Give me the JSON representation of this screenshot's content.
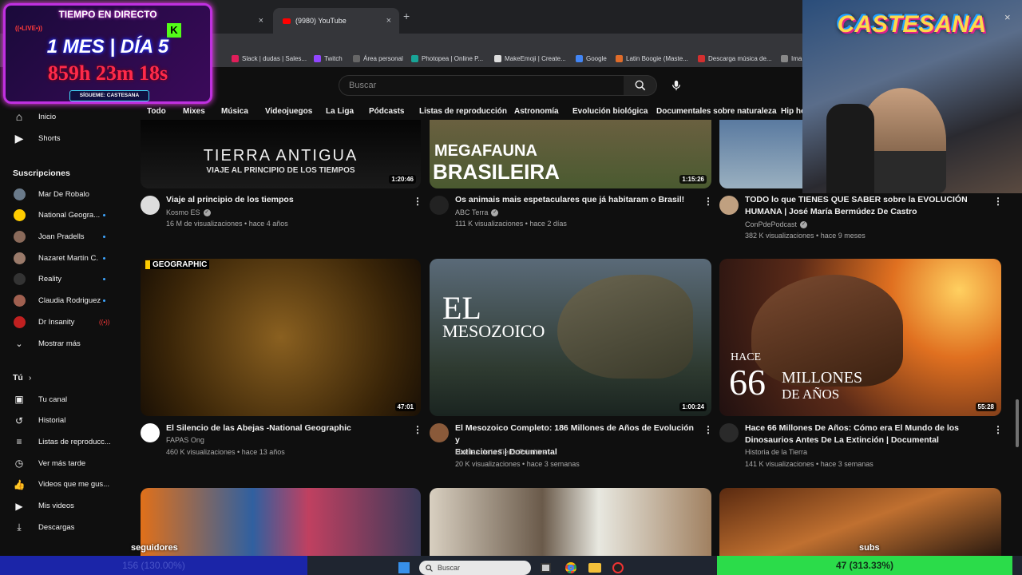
{
  "browser": {
    "active_tab_title": "(9980) YouTube",
    "new_tab_symbol": "+",
    "close_symbol": "×",
    "bookmarks": [
      {
        "label": "Slack | dudas | Sales...",
        "color": "#e01e5a"
      },
      {
        "label": "Twitch",
        "color": "#9146ff"
      },
      {
        "label": "Área personal",
        "color": "#666666"
      },
      {
        "label": "Photopea | Online P...",
        "color": "#18a497"
      },
      {
        "label": "MakeEmoji | Create...",
        "color": "#dddddd"
      },
      {
        "label": "Google",
        "color": "#4285f4"
      },
      {
        "label": "Latin Boogie (Maste...",
        "color": "#e06c2a"
      },
      {
        "label": "Descarga música de...",
        "color": "#d32f2f"
      },
      {
        "label": "Ima",
        "color": "#888888"
      }
    ]
  },
  "youtube": {
    "search_placeholder": "Buscar",
    "chips": [
      "Todo",
      "Mixes",
      "Música",
      "Videojuegos",
      "La Liga",
      "Pódcasts",
      "Listas de reproducción",
      "Astronomía",
      "Evolución biológica",
      "Documentales sobre naturaleza",
      "Hip ho"
    ]
  },
  "sidebar": {
    "main": [
      {
        "label": "Inicio",
        "icon": "home-icon"
      },
      {
        "label": "Shorts",
        "icon": "shorts-icon"
      }
    ],
    "subs_heading": "Suscripciones",
    "subs": [
      {
        "label": "Mar De Robalo",
        "color": "#6a7a8a",
        "live": false,
        "dot": false
      },
      {
        "label": "National Geogra...",
        "color": "#ffcc00",
        "live": false,
        "dot": true
      },
      {
        "label": "Joan Pradells",
        "color": "#8a6a5a",
        "live": false,
        "dot": true
      },
      {
        "label": "Nazaret Martín C.",
        "color": "#9a7a6a",
        "live": false,
        "dot": true
      },
      {
        "label": "Reality",
        "color": "#333333",
        "live": false,
        "dot": true
      },
      {
        "label": "Claudia Rodriguez",
        "color": "#a06050",
        "live": false,
        "dot": true
      },
      {
        "label": "Dr Insanity",
        "color": "#c02020",
        "live": true,
        "dot": false
      }
    ],
    "show_more": "Mostrar más",
    "you_heading": "Tú",
    "you_items": [
      {
        "label": "Tu canal",
        "icon": "channel-icon"
      },
      {
        "label": "Historial",
        "icon": "history-icon"
      },
      {
        "label": "Listas de reproducc...",
        "icon": "playlist-icon"
      },
      {
        "label": "Ver más tarde",
        "icon": "watch-later-icon"
      },
      {
        "label": "Videos que me gus...",
        "icon": "like-icon"
      },
      {
        "label": "Mis videos",
        "icon": "my-videos-icon"
      },
      {
        "label": "Descargas",
        "icon": "download-icon"
      }
    ]
  },
  "videos_row1": [
    {
      "thumb_text1": "TIERRA ANTIGUA",
      "thumb_text2": "VIAJE AL PRINCIPIO DE LOS TIEMPOS",
      "duration": "1:20:46",
      "title": "Viaje al principio de los tiempos",
      "title2": "",
      "channel": "Kosmo ES",
      "meta": "16 M de visualizaciones • hace 4 años",
      "avatar_color": "#dddddd"
    },
    {
      "thumb_text1": "MEGAFAUNA",
      "thumb_text2": "BRASILEIRA",
      "duration": "1:15:26",
      "title": "Os animais mais espetaculares que já habitaram o Brasil!",
      "title2": "",
      "channel": "ABC Terra",
      "meta": "111 K visualizaciones • hace 2 días",
      "avatar_color": "#222222"
    },
    {
      "thumb_text1": "",
      "thumb_text2": "",
      "duration": "",
      "title": "TODO lo que TIENES QUE SABER sobre la EVOLUCIÓN",
      "title2": "HUMANA | José María Bermúdez De Castro",
      "channel": "ConPdePodcast",
      "meta": "382 K visualizaciones • hace 9 meses",
      "avatar_color": "#c0a080"
    }
  ],
  "videos_row2": [
    {
      "thumb_text1": "GEOGRAPHIC",
      "thumb_text2": "",
      "duration": "47:01",
      "title": "El Silencio de las Abejas -National Geographic",
      "title2": "",
      "channel": "FAPAS Ong",
      "meta": "460 K visualizaciones • hace 13 años",
      "avatar_color": "#ffffff"
    },
    {
      "thumb_text1": "EL",
      "thumb_text2": "MESOZOICO",
      "duration": "1:00:24",
      "title": "El Mesozoico Completo: 186 Millones de Años de Evolución y",
      "title2": "Extinciones | Documental",
      "channel": "Huellas de la Tierra Primitiva",
      "meta": "20 K visualizaciones • hace 3 semanas",
      "avatar_color": "#8a5a3a"
    },
    {
      "thumb_text1": "HACE",
      "thumb_text2": "66",
      "thumb_text3": "MILLONES",
      "thumb_text4": "DE AÑOS",
      "duration": "55:28",
      "title": "Hace 66 Millones De Años: Cómo era El Mundo de los",
      "title2": "Dinosaurios Antes De La Extinción | Documental",
      "channel": "Historia de la Tierra",
      "meta": "141 K visualizaciones • hace 3 semanas",
      "avatar_color": "#2a2a2a"
    }
  ],
  "overlays": {
    "timer_title": "TIEMPO EN DIRECTO",
    "timer_live": "((•LIVE•))",
    "timer_day": "1 MES | DÍA 5",
    "timer_time": "859h 23m 18s",
    "timer_follow": "SÍGUEME: CASTESANA",
    "brand": "CASTESANA",
    "followers_label": "seguidores",
    "subs_label": "subs",
    "followers_value": "156 (130.00%)",
    "subs_value": "47 (313.33%)"
  },
  "taskbar": {
    "search_label": "Buscar"
  }
}
